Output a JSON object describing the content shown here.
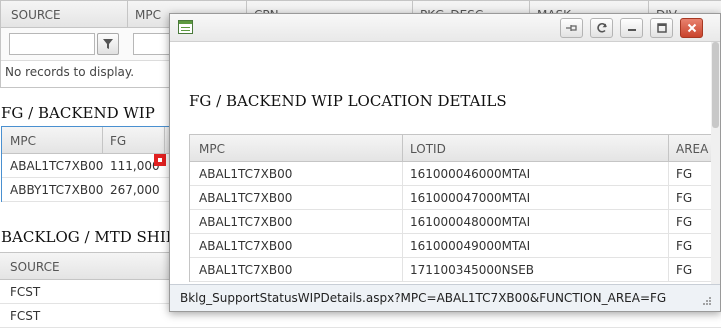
{
  "background": {
    "top_grid": {
      "columns": [
        "SOURCE",
        "MPC",
        "CPN",
        "PKG_DESC",
        "MASK",
        "DIV"
      ],
      "empty_message": "No records to display."
    },
    "section2": {
      "title": "FG / BACKEND WIP",
      "columns": [
        "MPC",
        "FG"
      ],
      "rows": [
        {
          "mpc": "ABAL1TC7XB00",
          "fg": "111,000"
        },
        {
          "mpc": "ABBY1TC7XB00",
          "fg": "267,000"
        }
      ]
    },
    "section3": {
      "title": "BACKLOG / MTD SHIPMENT",
      "columns": [
        "SOURCE"
      ],
      "rows": [
        "FCST",
        "FCST"
      ]
    }
  },
  "window": {
    "heading": "FG / BACKEND WIP LOCATION DETAILS",
    "columns": [
      "MPC",
      "LOTID",
      "AREA"
    ],
    "rows": [
      {
        "mpc": "ABAL1TC7XB00",
        "lotid": "161000046000MTAI",
        "area": "FG"
      },
      {
        "mpc": "ABAL1TC7XB00",
        "lotid": "161000047000MTAI",
        "area": "FG"
      },
      {
        "mpc": "ABAL1TC7XB00",
        "lotid": "161000048000MTAI",
        "area": "FG"
      },
      {
        "mpc": "ABAL1TC7XB00",
        "lotid": "161000049000MTAI",
        "area": "FG"
      },
      {
        "mpc": "ABAL1TC7XB00",
        "lotid": "171100345000NSEB",
        "area": "FG"
      }
    ],
    "status_url": "Bklg_SupportStatusWIPDetails.aspx?MPC=ABAL1TC7XB00&FUNCTION_AREA=FG",
    "buttons": [
      "pin-icon",
      "reload-icon",
      "minimize-icon",
      "maximize-icon",
      "close-icon"
    ]
  },
  "colors": {
    "accent": "#4a90d0",
    "close": "#c9432c",
    "marker": "#e02020"
  }
}
